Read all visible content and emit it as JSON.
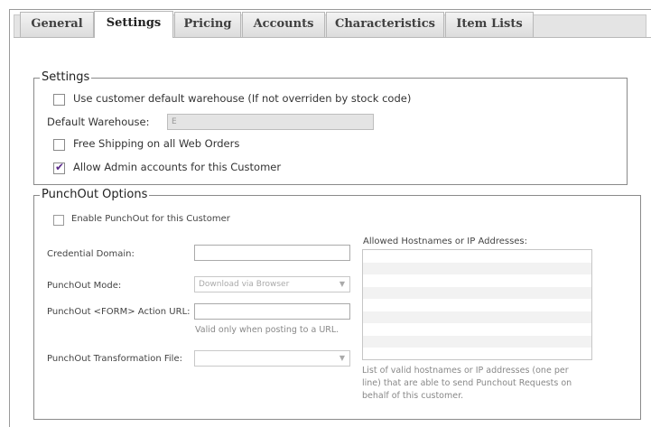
{
  "tabs": [
    {
      "label": "General",
      "active": false
    },
    {
      "label": "Settings",
      "active": true
    },
    {
      "label": "Pricing",
      "active": false
    },
    {
      "label": "Accounts",
      "active": false
    },
    {
      "label": "Characteristics",
      "active": false
    },
    {
      "label": "Item Lists",
      "active": false
    }
  ],
  "settings": {
    "legend": "Settings",
    "use_default_warehouse": {
      "label": "Use customer default warehouse (If not overriden by stock code)",
      "checked": false
    },
    "default_warehouse_label": "Default Warehouse:",
    "default_warehouse_value": "E",
    "free_shipping": {
      "label": "Free Shipping on all Web Orders",
      "checked": false
    },
    "allow_admin": {
      "label": "Allow Admin accounts for this Customer",
      "checked": true
    }
  },
  "punchout": {
    "legend": "PunchOut Options",
    "enable": {
      "label": "Enable PunchOut for this Customer",
      "checked": false
    },
    "credential_domain_label": "Credential Domain:",
    "credential_domain_value": "",
    "mode_label": "PunchOut Mode:",
    "mode_value": "Download via Browser",
    "form_action_label": "PunchOut <FORM> Action URL:",
    "form_action_value": "",
    "form_action_help": "Valid only when posting to a URL.",
    "transformation_label": "PunchOut Transformation File:",
    "transformation_value": "",
    "allowed_hosts_label": "Allowed Hostnames or IP Addresses:",
    "allowed_hosts_help_1": "List of valid hostnames or IP addresses (one per",
    "allowed_hosts_help_2": "line) that are able to send Punchout Requests on",
    "allowed_hosts_help_3": "behalf of this customer."
  },
  "icons": {
    "checkmark": "checkmark-icon",
    "dropdown": "chevron-down-icon"
  },
  "colors": {
    "check": "#5a2a8a",
    "disabled_input": "#e4e4e4",
    "tab_bar": "#e4e4e4"
  }
}
